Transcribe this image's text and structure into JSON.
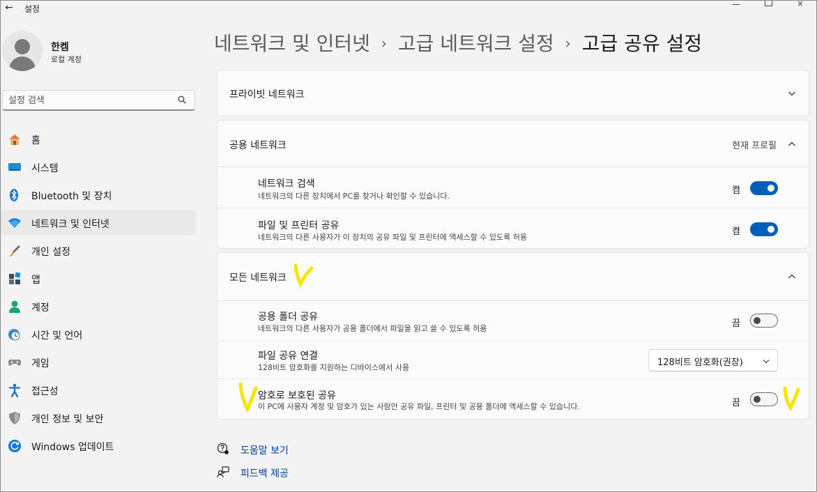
{
  "window": {
    "title": "설정"
  },
  "profile": {
    "name": "한켐",
    "account_type": "로컬 계정"
  },
  "search": {
    "placeholder": "설정 검색"
  },
  "sidebar": {
    "items": [
      {
        "label": "홈",
        "icon": "home-icon"
      },
      {
        "label": "시스템",
        "icon": "system-icon"
      },
      {
        "label": "Bluetooth 및 장치",
        "icon": "bluetooth-icon"
      },
      {
        "label": "네트워크 및 인터넷",
        "icon": "wifi-icon",
        "active": true
      },
      {
        "label": "개인 설정",
        "icon": "brush-icon"
      },
      {
        "label": "앱",
        "icon": "apps-icon"
      },
      {
        "label": "계정",
        "icon": "account-icon"
      },
      {
        "label": "시간 및 언어",
        "icon": "clock-globe-icon"
      },
      {
        "label": "게임",
        "icon": "gamepad-icon"
      },
      {
        "label": "접근성",
        "icon": "accessibility-icon"
      },
      {
        "label": "개인 정보 및 보안",
        "icon": "shield-icon"
      },
      {
        "label": "Windows 업데이트",
        "icon": "update-icon"
      }
    ]
  },
  "breadcrumb": {
    "items": [
      "네트워크 및 인터넷",
      "고급 네트워크 설정"
    ],
    "current": "고급 공유 설정"
  },
  "sections": {
    "private": {
      "title": "프라이빗 네트워크",
      "expanded": false
    },
    "public": {
      "title": "공용 네트워크",
      "tag": "현재 프로필",
      "expanded": true,
      "rows": [
        {
          "title": "네트워크 검색",
          "desc": "네트워크의 다른 장치에서 PC를 찾거나 확인할 수 있습니다.",
          "state": "켬",
          "on": true
        },
        {
          "title": "파일 및 프린터 공유",
          "desc": "네트워크의 다른 사용자가 이 장치의 공유 파일 및 프린터에 액세스할 수 있도록 허용",
          "state": "켬",
          "on": true
        }
      ]
    },
    "all": {
      "title": "모든 네트워크",
      "expanded": true,
      "rows": [
        {
          "title": "공용 폴더 공유",
          "desc": "네트워크의 다른 사용자가 공용 폴더에서 파일을 읽고 쓸 수 있도록 허용",
          "state": "끔",
          "on": false
        },
        {
          "title": "파일 공유 연결",
          "desc": "128비트 암호화를 지원하는 디바이스에서 사용",
          "select": "128비트 암호화(권장)"
        },
        {
          "title": "암호로 보호된 공유",
          "desc": "이 PC에 사용자 계정 및 암호가 있는 사람만 공유 파일, 프린터 및 공용 폴더에 액세스할 수 있습니다.",
          "state": "끔",
          "on": false
        }
      ]
    }
  },
  "footer": {
    "help": "도움말 보기",
    "feedback": "피드백 제공"
  },
  "colors": {
    "accent": "#005fb8",
    "annotation": "#f5e600"
  }
}
